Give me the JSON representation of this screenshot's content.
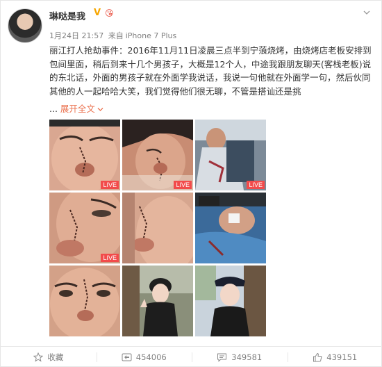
{
  "header": {
    "username": "琳哒是我",
    "verified_badge": "V",
    "emoji_badge": "😘",
    "timestamp": "1月24日 21:57",
    "source_prefix": "来自",
    "source": "iPhone 7 Plus"
  },
  "post": {
    "text": "丽江打人抢劫事件：2016年11月11日凌晨三点半到宁蒗烧烤，由烧烤店老板安排到包间里面，稍后到来十几个男孩子，大概是12个人，中途我跟朋友聊天(客栈老板)说的东北话，外面的男孩子就在外面学我说话，我说一句他就在外面学一句，然后伙同其他的人一起哈哈大笑，我们觉得他们很无聊，不管是搭讪还是挑",
    "ellipsis": "...",
    "expand_label": "展开全文",
    "expand_icon": "chevron-down"
  },
  "photos": [
    {
      "live": "LIVE"
    },
    {
      "live": "LIVE"
    },
    {
      "live": "LIVE"
    },
    {
      "live": "LIVE"
    },
    {
      "live": ""
    },
    {
      "live": ""
    },
    {
      "live": ""
    },
    {
      "live": ""
    },
    {
      "live": ""
    }
  ],
  "actions": {
    "favorite_label": "收藏",
    "repost_count": "454006",
    "comment_count": "349581",
    "like_count": "439151"
  },
  "colors": {
    "accent": "#eb7350",
    "live_badge": "#f24b4b",
    "verified": "#f7a600",
    "meta_text": "#808080"
  }
}
